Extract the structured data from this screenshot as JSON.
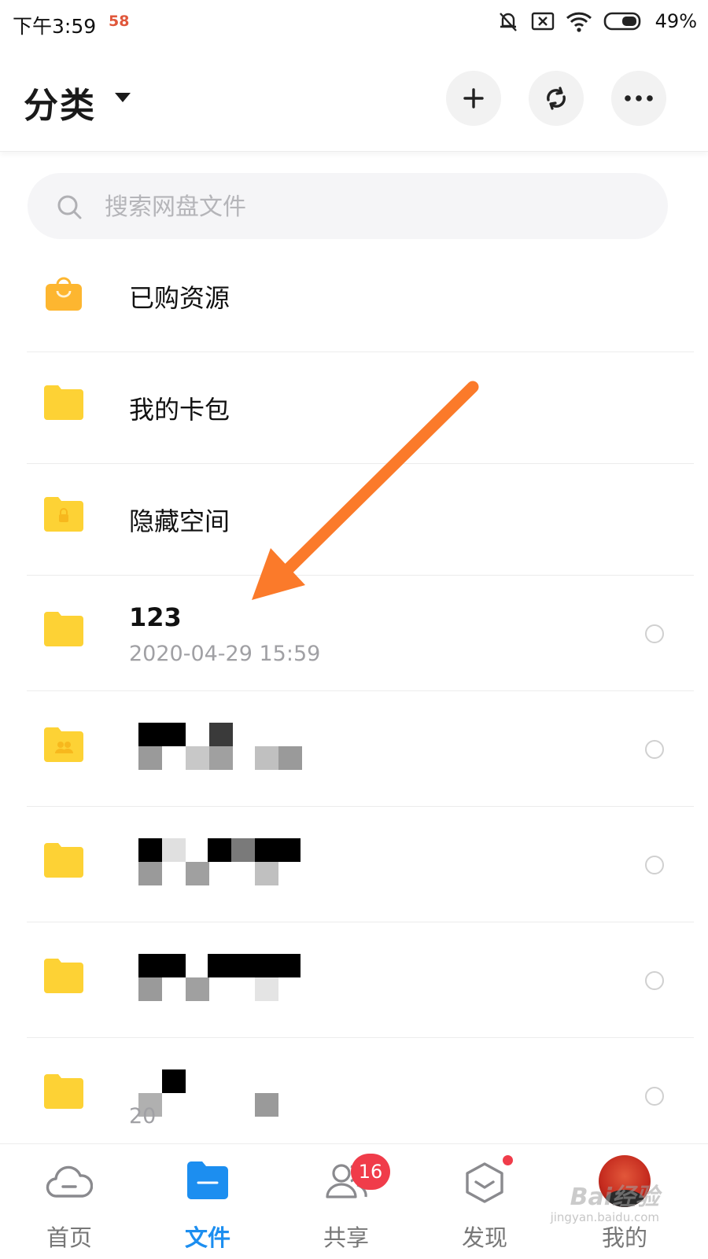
{
  "status_bar": {
    "time": "下午3:59",
    "app_badge": "58",
    "battery": "49%"
  },
  "header": {
    "title": "分类",
    "buttons": [
      "plus-icon",
      "sync-icon",
      "more-icon"
    ]
  },
  "search": {
    "placeholder": "搜索网盘文件"
  },
  "categories": [
    {
      "icon": "shopping-bag-icon",
      "label": "已购资源"
    },
    {
      "icon": "folder-icon",
      "label": "我的卡包"
    },
    {
      "icon": "locked-folder-icon",
      "label": "隐藏空间"
    }
  ],
  "files": [
    {
      "icon": "folder-icon",
      "name": "123",
      "date": "2020-04-29  15:59",
      "obscured": false
    },
    {
      "icon": "shared-folder-icon",
      "name": "",
      "date": "",
      "obscured": true
    },
    {
      "icon": "folder-icon",
      "name": "",
      "date": "",
      "obscured": true
    },
    {
      "icon": "folder-icon",
      "name": "",
      "date": "",
      "obscured": true
    },
    {
      "icon": "folder-icon",
      "name": "",
      "date": "20",
      "obscured": true
    }
  ],
  "tabs": [
    {
      "label": "首页",
      "icon": "cloud-icon",
      "active": false
    },
    {
      "label": "文件",
      "icon": "folder-tab-icon",
      "active": true
    },
    {
      "label": "共享",
      "icon": "people-icon",
      "active": false,
      "badge": "16"
    },
    {
      "label": "发现",
      "icon": "discover-icon",
      "active": false,
      "dot": true
    },
    {
      "label": "我的",
      "icon": "avatar",
      "active": false
    }
  ],
  "watermark": {
    "text": "Bai经验",
    "sub": "jingyan.baidu.com"
  },
  "colors": {
    "accent": "#1c8ef0",
    "folder": "#fdd235",
    "badge": "#f03c4a",
    "arrow": "#fb7a2a"
  }
}
